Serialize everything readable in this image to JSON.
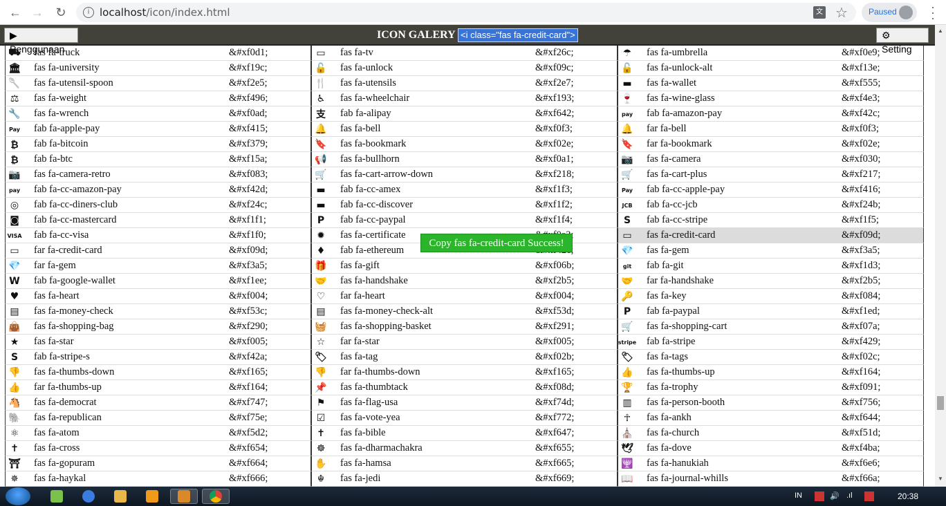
{
  "browser": {
    "url_host": "localhost",
    "url_path": "/icon/index.html",
    "profile_status": "Paused"
  },
  "header": {
    "usage_button": "Penggunaan",
    "title": "ICON GALERY",
    "selected_code": "<i class=\"fas fa-credit-card\">",
    "setting_button": "Setting"
  },
  "toast": "Copy fas fa-credit-card Success!",
  "icons": [
    {
      "glyph": "⛟",
      "cls": "fas fa-truck",
      "code": "&#xf0d1;"
    },
    {
      "glyph": "▭",
      "cls": "fas fa-tv",
      "code": "&#xf26c;"
    },
    {
      "glyph": "☂",
      "cls": "fas fa-umbrella",
      "code": "&#xf0e9;"
    },
    {
      "glyph": "🏛",
      "cls": "fas fa-university",
      "code": "&#xf19c;"
    },
    {
      "glyph": "🔓",
      "cls": "fas fa-unlock",
      "code": "&#xf09c;"
    },
    {
      "glyph": "🔓",
      "cls": "fas fa-unlock-alt",
      "code": "&#xf13e;"
    },
    {
      "glyph": "🥄",
      "cls": "fas fa-utensil-spoon",
      "code": "&#xf2e5;"
    },
    {
      "glyph": "🍴",
      "cls": "fas fa-utensils",
      "code": "&#xf2e7;"
    },
    {
      "glyph": "▬",
      "cls": "fas fa-wallet",
      "code": "&#xf555;"
    },
    {
      "glyph": "⚖",
      "cls": "fas fa-weight",
      "code": "&#xf496;"
    },
    {
      "glyph": "♿",
      "cls": "fas fa-wheelchair",
      "code": "&#xf193;"
    },
    {
      "glyph": "🍷",
      "cls": "fas fa-wine-glass",
      "code": "&#xf4e3;"
    },
    {
      "glyph": "🔧",
      "cls": "fas fa-wrench",
      "code": "&#xf0ad;"
    },
    {
      "glyph": "支",
      "cls": "fab fa-alipay",
      "code": "&#xf642;"
    },
    {
      "glyph": "pay",
      "cls": "fab fa-amazon-pay",
      "code": "&#xf42c;"
    },
    {
      "glyph": "Pay",
      "cls": "fab fa-apple-pay",
      "code": "&#xf415;"
    },
    {
      "glyph": "🔔",
      "cls": "fas fa-bell",
      "code": "&#xf0f3;"
    },
    {
      "glyph": "🔔",
      "cls": "far fa-bell",
      "code": "&#xf0f3;"
    },
    {
      "glyph": "₿",
      "cls": "fab fa-bitcoin",
      "code": "&#xf379;"
    },
    {
      "glyph": "🔖",
      "cls": "fas fa-bookmark",
      "code": "&#xf02e;"
    },
    {
      "glyph": "🔖",
      "cls": "far fa-bookmark",
      "code": "&#xf02e;"
    },
    {
      "glyph": "₿",
      "cls": "fab fa-btc",
      "code": "&#xf15a;"
    },
    {
      "glyph": "📢",
      "cls": "fas fa-bullhorn",
      "code": "&#xf0a1;"
    },
    {
      "glyph": "📷",
      "cls": "fas fa-camera",
      "code": "&#xf030;"
    },
    {
      "glyph": "📷",
      "cls": "fas fa-camera-retro",
      "code": "&#xf083;"
    },
    {
      "glyph": "🛒",
      "cls": "fas fa-cart-arrow-down",
      "code": "&#xf218;"
    },
    {
      "glyph": "🛒",
      "cls": "fas fa-cart-plus",
      "code": "&#xf217;"
    },
    {
      "glyph": "pay",
      "cls": "fab fa-cc-amazon-pay",
      "code": "&#xf42d;"
    },
    {
      "glyph": "▬",
      "cls": "fab fa-cc-amex",
      "code": "&#xf1f3;"
    },
    {
      "glyph": "Pay",
      "cls": "fab fa-cc-apple-pay",
      "code": "&#xf416;"
    },
    {
      "glyph": "◎",
      "cls": "fab fa-cc-diners-club",
      "code": "&#xf24c;"
    },
    {
      "glyph": "▬",
      "cls": "fab fa-cc-discover",
      "code": "&#xf1f2;"
    },
    {
      "glyph": "JCB",
      "cls": "fab fa-cc-jcb",
      "code": "&#xf24b;"
    },
    {
      "glyph": "◙",
      "cls": "fab fa-cc-mastercard",
      "code": "&#xf1f1;"
    },
    {
      "glyph": "P",
      "cls": "fab fa-cc-paypal",
      "code": "&#xf1f4;"
    },
    {
      "glyph": "S",
      "cls": "fab fa-cc-stripe",
      "code": "&#xf1f5;"
    },
    {
      "glyph": "VISA",
      "cls": "fab fa-cc-visa",
      "code": "&#xf1f0;"
    },
    {
      "glyph": "✹",
      "cls": "fas fa-certificate",
      "code": "&#xf0a3;"
    },
    {
      "glyph": "▭",
      "cls": "fas fa-credit-card",
      "code": "&#xf09d;"
    },
    {
      "glyph": "▭",
      "cls": "far fa-credit-card",
      "code": "&#xf09d;"
    },
    {
      "glyph": "♦",
      "cls": "fab fa-ethereum",
      "code": "&#xf42e;"
    },
    {
      "glyph": "💎",
      "cls": "fas fa-gem",
      "code": "&#xf3a5;"
    },
    {
      "glyph": "💎",
      "cls": "far fa-gem",
      "code": "&#xf3a5;"
    },
    {
      "glyph": "🎁",
      "cls": "fas fa-gift",
      "code": "&#xf06b;"
    },
    {
      "glyph": "git",
      "cls": "fab fa-git",
      "code": "&#xf1d3;"
    },
    {
      "glyph": "W",
      "cls": "fab fa-google-wallet",
      "code": "&#xf1ee;"
    },
    {
      "glyph": "🤝",
      "cls": "fas fa-handshake",
      "code": "&#xf2b5;"
    },
    {
      "glyph": "🤝",
      "cls": "far fa-handshake",
      "code": "&#xf2b5;"
    },
    {
      "glyph": "♥",
      "cls": "fas fa-heart",
      "code": "&#xf004;"
    },
    {
      "glyph": "♡",
      "cls": "far fa-heart",
      "code": "&#xf004;"
    },
    {
      "glyph": "🔑",
      "cls": "fas fa-key",
      "code": "&#xf084;"
    },
    {
      "glyph": "▤",
      "cls": "fas fa-money-check",
      "code": "&#xf53c;"
    },
    {
      "glyph": "▤",
      "cls": "fas fa-money-check-alt",
      "code": "&#xf53d;"
    },
    {
      "glyph": "P",
      "cls": "fab fa-paypal",
      "code": "&#xf1ed;"
    },
    {
      "glyph": "👜",
      "cls": "fas fa-shopping-bag",
      "code": "&#xf290;"
    },
    {
      "glyph": "🧺",
      "cls": "fas fa-shopping-basket",
      "code": "&#xf291;"
    },
    {
      "glyph": "🛒",
      "cls": "fas fa-shopping-cart",
      "code": "&#xf07a;"
    },
    {
      "glyph": "★",
      "cls": "fas fa-star",
      "code": "&#xf005;"
    },
    {
      "glyph": "☆",
      "cls": "far fa-star",
      "code": "&#xf005;"
    },
    {
      "glyph": "stripe",
      "cls": "fab fa-stripe",
      "code": "&#xf429;"
    },
    {
      "glyph": "S",
      "cls": "fab fa-stripe-s",
      "code": "&#xf42a;"
    },
    {
      "glyph": "🏷",
      "cls": "fas fa-tag",
      "code": "&#xf02b;"
    },
    {
      "glyph": "🏷",
      "cls": "fas fa-tags",
      "code": "&#xf02c;"
    },
    {
      "glyph": "👎",
      "cls": "fas fa-thumbs-down",
      "code": "&#xf165;"
    },
    {
      "glyph": "👎",
      "cls": "far fa-thumbs-down",
      "code": "&#xf165;"
    },
    {
      "glyph": "👍",
      "cls": "fas fa-thumbs-up",
      "code": "&#xf164;"
    },
    {
      "glyph": "👍",
      "cls": "far fa-thumbs-up",
      "code": "&#xf164;"
    },
    {
      "glyph": "📌",
      "cls": "fas fa-thumbtack",
      "code": "&#xf08d;"
    },
    {
      "glyph": "🏆",
      "cls": "fas fa-trophy",
      "code": "&#xf091;"
    },
    {
      "glyph": "🐴",
      "cls": "fas fa-democrat",
      "code": "&#xf747;"
    },
    {
      "glyph": "⚑",
      "cls": "fas fa-flag-usa",
      "code": "&#xf74d;"
    },
    {
      "glyph": "▥",
      "cls": "fas fa-person-booth",
      "code": "&#xf756;"
    },
    {
      "glyph": "🐘",
      "cls": "fas fa-republican",
      "code": "&#xf75e;"
    },
    {
      "glyph": "☑",
      "cls": "fas fa-vote-yea",
      "code": "&#xf772;"
    },
    {
      "glyph": "☥",
      "cls": "fas fa-ankh",
      "code": "&#xf644;"
    },
    {
      "glyph": "⚛",
      "cls": "fas fa-atom",
      "code": "&#xf5d2;"
    },
    {
      "glyph": "✝",
      "cls": "fas fa-bible",
      "code": "&#xf647;"
    },
    {
      "glyph": "⛪",
      "cls": "fas fa-church",
      "code": "&#xf51d;"
    },
    {
      "glyph": "✝",
      "cls": "fas fa-cross",
      "code": "&#xf654;"
    },
    {
      "glyph": "☸",
      "cls": "fas fa-dharmachakra",
      "code": "&#xf655;"
    },
    {
      "glyph": "🕊",
      "cls": "fas fa-dove",
      "code": "&#xf4ba;"
    },
    {
      "glyph": "⛩",
      "cls": "fas fa-gopuram",
      "code": "&#xf664;"
    },
    {
      "glyph": "✋",
      "cls": "fas fa-hamsa",
      "code": "&#xf665;"
    },
    {
      "glyph": "🕎",
      "cls": "fas fa-hanukiah",
      "code": "&#xf6e6;"
    },
    {
      "glyph": "✵",
      "cls": "fas fa-haykal",
      "code": "&#xf666;"
    },
    {
      "glyph": "☬",
      "cls": "fas fa-jedi",
      "code": "&#xf669;"
    },
    {
      "glyph": "📖",
      "cls": "fas fa-journal-whills",
      "code": "&#xf66a;"
    }
  ],
  "taskbar": {
    "language": "IN",
    "time": "20:38"
  }
}
